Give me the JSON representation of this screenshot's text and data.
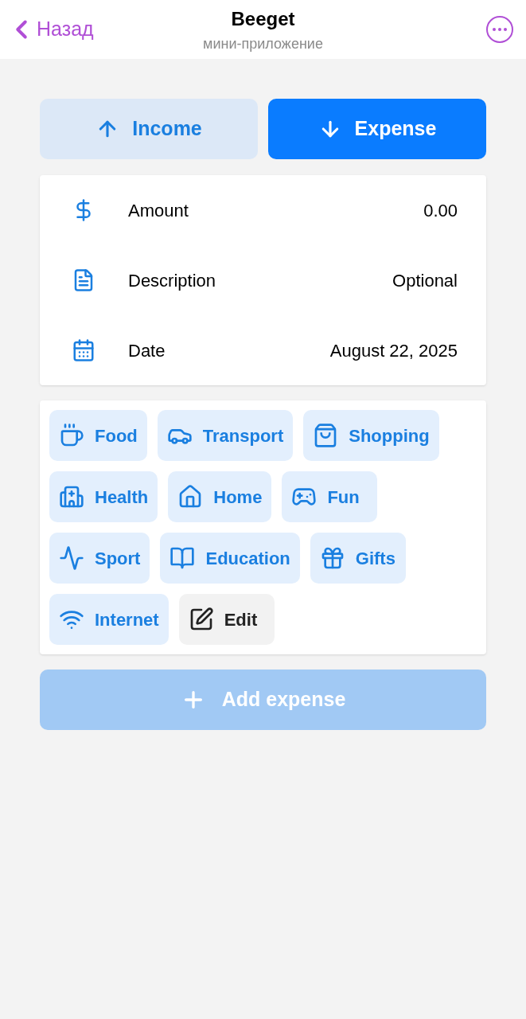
{
  "header": {
    "back": "Назад",
    "title": "Beeget",
    "subtitle": "мини-приложение"
  },
  "type_tabs": [
    {
      "label": "Income",
      "kind": "income",
      "selected": false
    },
    {
      "label": "Expense",
      "kind": "expense",
      "selected": true
    }
  ],
  "form": [
    {
      "kind": "amount",
      "label": "Amount",
      "value": "0.00"
    },
    {
      "kind": "description",
      "label": "Description",
      "value": "Optional"
    },
    {
      "kind": "date",
      "label": "Date",
      "value": "August 22, 2025"
    }
  ],
  "categories": [
    {
      "label": "Food",
      "kind": "category"
    },
    {
      "label": "Transport",
      "kind": "category"
    },
    {
      "label": "Shopping",
      "kind": "category"
    },
    {
      "label": "Health",
      "kind": "category"
    },
    {
      "label": "Home",
      "kind": "category"
    },
    {
      "label": "Fun",
      "kind": "category"
    },
    {
      "label": "Sport",
      "kind": "category"
    },
    {
      "label": "Education",
      "kind": "category"
    },
    {
      "label": "Gifts",
      "kind": "category"
    },
    {
      "label": "Internet",
      "kind": "category"
    },
    {
      "label": "Edit",
      "kind": "edit"
    }
  ],
  "submit": {
    "label": "Add expense",
    "disabled": true
  }
}
